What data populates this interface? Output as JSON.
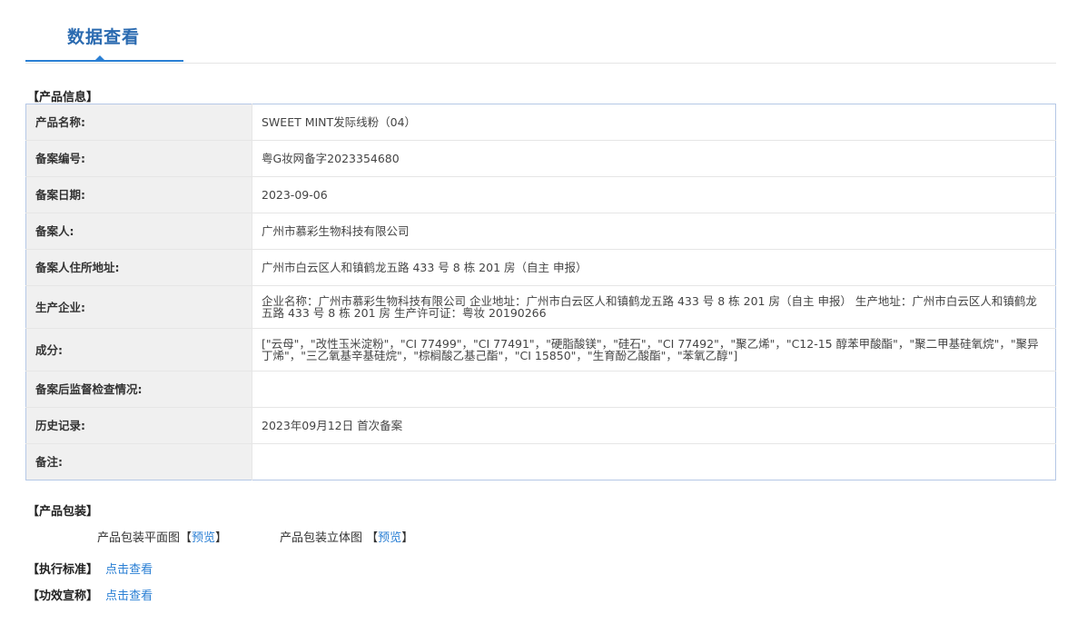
{
  "header": {
    "title": "数据查看"
  },
  "product_info": {
    "section_title": "【产品信息】",
    "rows": [
      {
        "label": "产品名称:",
        "value": "SWEET MINT发际线粉（04）"
      },
      {
        "label": "备案编号:",
        "value": "粤G妆网备字2023354680"
      },
      {
        "label": "备案日期:",
        "value": "2023-09-06"
      },
      {
        "label": "备案人:",
        "value": "广州市慕彩生物科技有限公司"
      },
      {
        "label": "备案人住所地址:",
        "value": "广州市白云区人和镇鹤龙五路 433 号 8 栋 201 房（自主 申报）"
      },
      {
        "label": "生产企业:",
        "value": "企业名称：广州市慕彩生物科技有限公司 企业地址：广州市白云区人和镇鹤龙五路 433 号 8 栋 201 房（自主 申报） 生产地址：广州市白云区人和镇鹤龙五路 433 号 8 栋 201 房 生产许可证：粤妆 20190266"
      },
      {
        "label": "成分:",
        "value": "[\"云母\"，\"改性玉米淀粉\"，\"CI 77499\"，\"CI 77491\"，\"硬脂酸镁\"，\"硅石\"，\"CI 77492\"，\"聚乙烯\"，\"C12-15 醇苯甲酸酯\"，\"聚二甲基硅氧烷\"，\"聚异丁烯\"，\"三乙氧基辛基硅烷\"，\"棕榈酸乙基己酯\"，\"CI 15850\"，\"生育酚乙酸酯\"，\"苯氧乙醇\"]"
      },
      {
        "label": "备案后监督检查情况:",
        "value": ""
      },
      {
        "label": "历史记录:",
        "value": "2023年09月12日 首次备案"
      },
      {
        "label": "备注:",
        "value": ""
      }
    ]
  },
  "packaging": {
    "section_title": "【产品包装】",
    "flat_label": "产品包装平面图",
    "flat_bracket_open": "【",
    "flat_link": "预览",
    "flat_bracket_close": "】",
    "stereo_label": "产品包装立体图",
    "stereo_bracket_open": "【",
    "stereo_link": "预览",
    "stereo_bracket_close": "】"
  },
  "standard": {
    "label": "【执行标准】",
    "link": "点击查看"
  },
  "efficacy": {
    "label": "【功效宣称】",
    "link": "点击查看"
  }
}
